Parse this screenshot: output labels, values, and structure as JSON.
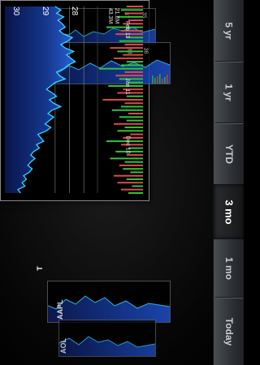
{
  "range_selector": {
    "items": [
      {
        "label": "Today",
        "selected": false
      },
      {
        "label": "1 mo",
        "selected": false
      },
      {
        "label": "3 mo",
        "selected": true
      },
      {
        "label": "YTD",
        "selected": false
      },
      {
        "label": "1 yr",
        "selected": false
      },
      {
        "label": "5 yr",
        "selected": false
      }
    ]
  },
  "background_cards": {
    "top_far": {
      "ticks": [
        "31",
        "33",
        "34",
        "35",
        "37"
      ]
    },
    "top_near": {
      "ticks": [
        "32",
        "34",
        "36",
        "38"
      ]
    },
    "bottom_near": {
      "ticker": "AAPL"
    },
    "bottom_far": {
      "ticker": "AOL"
    }
  },
  "main_chart": {
    "symbol": "T",
    "date_labels": [
      "Dec 10",
      "Jan 11",
      "Feb 11"
    ],
    "volume_labels": [
      "43.3M",
      "21.6M"
    ],
    "chart_data": {
      "type": "area",
      "y_ticks": [
        28,
        29,
        30
      ],
      "ylim": [
        24.5,
        30.5
      ],
      "price_series": [
        25.6,
        25.4,
        25.9,
        25.7,
        26.0,
        25.8,
        26.2,
        26.4,
        26.1,
        26.3,
        26.6,
        26.3,
        26.5,
        26.9,
        26.7,
        27.2,
        27.0,
        26.8,
        27.4,
        27.7,
        27.3,
        27.6,
        27.9,
        27.5,
        27.8,
        28.4,
        27.9,
        27.6,
        28.1,
        27.8,
        27.4,
        27.7,
        28.0,
        28.7,
        28.3,
        28.1,
        28.6,
        28.9,
        29.4,
        29.1,
        28.8,
        29.3,
        28.7,
        28.4,
        28.9,
        29.2,
        28.6,
        28.3,
        28.7,
        28.5,
        28.2,
        28.6,
        28.1,
        28.4,
        28.0
      ],
      "volume_series": [
        8,
        12,
        6,
        14,
        9,
        16,
        7,
        11,
        13,
        10,
        18,
        9,
        15,
        8,
        12,
        20,
        11,
        7,
        14,
        10,
        16,
        9,
        13,
        8,
        17,
        12,
        10,
        22,
        9,
        14,
        11,
        19,
        8,
        13,
        15,
        10,
        24,
        12,
        9,
        16,
        11,
        14,
        18,
        10,
        13,
        9,
        15,
        12,
        20,
        11,
        8,
        14,
        10,
        12,
        9
      ]
    }
  }
}
